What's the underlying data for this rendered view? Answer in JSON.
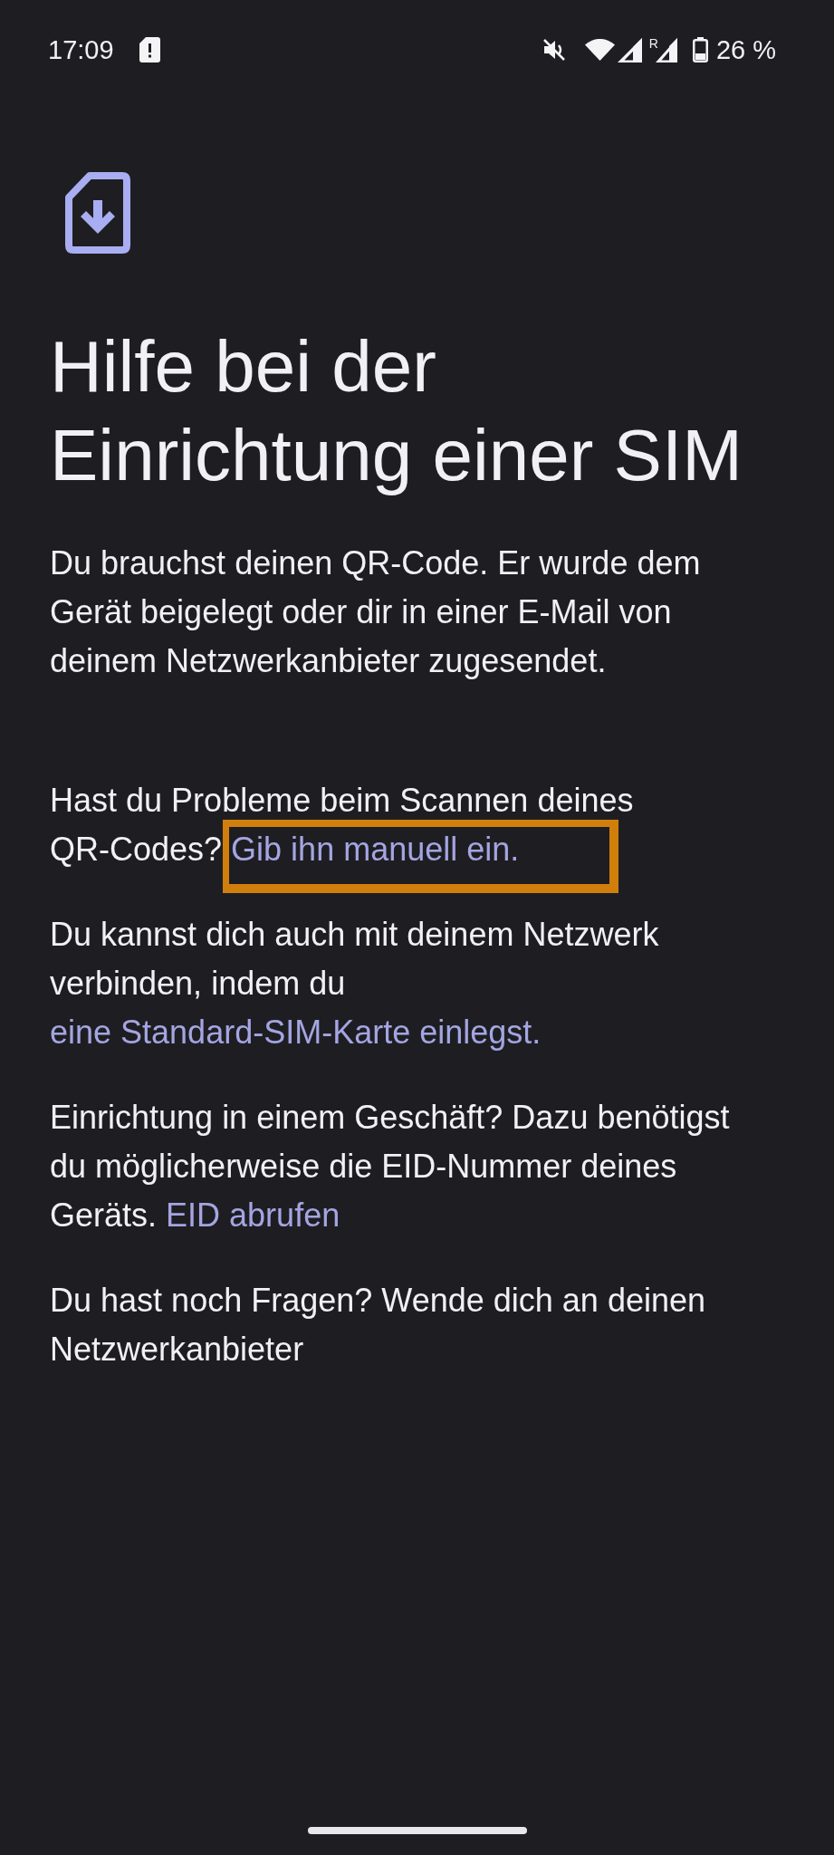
{
  "status_bar": {
    "time": "17:09",
    "roaming": "R",
    "battery": "26 %"
  },
  "title": "Hilfe bei der Einrichtung einer SIM",
  "paragraphs": [
    {
      "parts": [
        {
          "kind": "text",
          "text": "Du brauchst deinen QR-Code. Er wurde dem Gerät beigelegt oder dir in einer E-Mail von deinem Netzwerkanbieter zugesendet."
        }
      ]
    },
    {
      "parts": [
        {
          "kind": "text",
          "text": "Hast du Probleme beim Scannen deines QR-Codes?"
        },
        {
          "kind": "link",
          "text": "Gib ihn manuell ein.",
          "highlighted": true
        }
      ]
    },
    {
      "parts": [
        {
          "kind": "text",
          "text": "Du kannst dich auch mit deinem Netzwerk verbinden, indem du"
        },
        {
          "kind": "link",
          "text": "eine Standard-SIM-Karte einlegst.",
          "highlighted": false
        }
      ]
    },
    {
      "parts": [
        {
          "kind": "text",
          "text": "Einrichtung in einem Geschäft? Dazu benötigst du möglicherweise die EID-Nummer deines Geräts."
        },
        {
          "kind": "link",
          "text": "EID abrufen",
          "highlighted": false
        }
      ]
    },
    {
      "parts": [
        {
          "kind": "text",
          "text": "Du hast noch Fragen? Wende dich an deinen Netzwerkanbieter"
        }
      ]
    }
  ]
}
